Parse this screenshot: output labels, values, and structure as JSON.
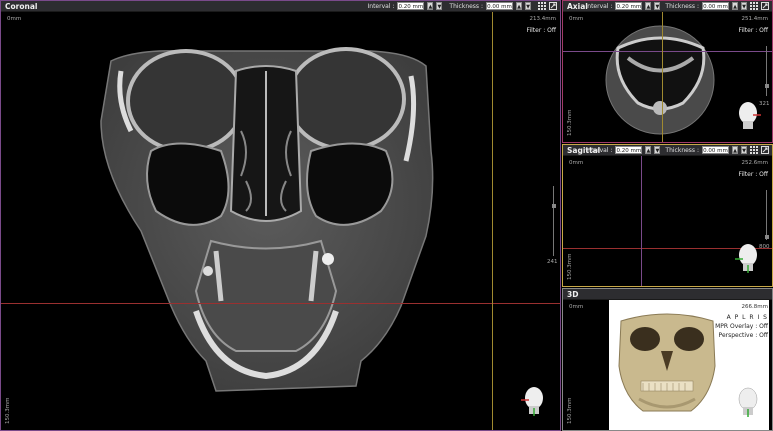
{
  "coronal": {
    "title": "Coronal",
    "interval_label": "Interval :",
    "interval_value": "0.20 mm",
    "thickness_label": "Thickness :",
    "thickness_value": "0.00 mm",
    "top_left": "0mm",
    "top_right": "213.4mm",
    "filter": "Filter : Off",
    "bottom_left": "150.3mm",
    "slider_value": "241"
  },
  "axial": {
    "title": "Axial",
    "interval_label": "Interval :",
    "interval_value": "0.20 mm",
    "thickness_label": "Thickness :",
    "thickness_value": "0.00 mm",
    "top_left": "0mm",
    "top_right": "251.4mm",
    "filter": "Filter : Off",
    "bottom_left": "150.3mm",
    "slider_value": "321"
  },
  "sagittal": {
    "title": "Sagittal",
    "interval_label": "Interval :",
    "interval_value": "0.20 mm",
    "thickness_label": "Thickness :",
    "thickness_value": "0.00 mm",
    "top_left": "0mm",
    "top_right": "252.6mm",
    "filter": "Filter : Off",
    "bottom_left": "150.3mm",
    "slider_value": "800"
  },
  "view3d": {
    "title": "3D",
    "top_left": "0mm",
    "top_right": "266.8mm",
    "orientation": "A  P  L  R  I  S",
    "mpr_overlay": "MPR Overlay : Off",
    "perspective": "Perspective : Off",
    "bottom_left": "150.3mm"
  },
  "colors": {
    "coronal_frame": "#7a4a8a",
    "axial_frame": "#a03a6a",
    "sagittal_frame": "#c8a848",
    "view3d_frame": "#888888",
    "crosshair_red": "#9a3030",
    "crosshair_yellow": "#a08a30",
    "crosshair_purple": "#7a4a8a"
  },
  "icons": {
    "grid": "grid-icon",
    "expand": "expand-icon",
    "spin_up": "▲",
    "spin_down": "▼"
  }
}
